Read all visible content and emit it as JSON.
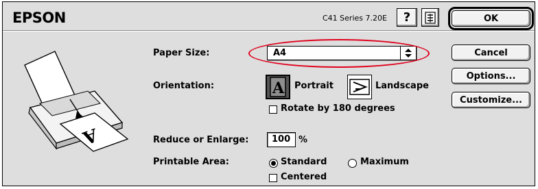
{
  "header": {
    "brand": "EPSON",
    "version": "C41 Series 7.20E",
    "help_glyph": "?",
    "utility_icon": "printer-utility-icon"
  },
  "buttons": {
    "ok": "OK",
    "cancel": "Cancel",
    "options": "Options...",
    "customize": "Customize..."
  },
  "paper_size": {
    "label": "Paper Size:",
    "value": "A4",
    "arrow_glyph": "⇕"
  },
  "orientation": {
    "label": "Orientation:",
    "portrait": "Portrait",
    "landscape": "Landscape",
    "selected": "Portrait",
    "rotate_label": "Rotate by 180 degrees",
    "rotate_checked": false
  },
  "scale": {
    "label": "Reduce or Enlarge:",
    "value": "100",
    "unit": "%"
  },
  "printable_area": {
    "label": "Printable Area:",
    "standard": "Standard",
    "maximum": "Maximum",
    "selected": "Standard",
    "centered_label": "Centered",
    "centered_checked": false
  },
  "colors": {
    "dialog_bg": "#dedede",
    "highlight_ellipse": "#e0001b"
  }
}
